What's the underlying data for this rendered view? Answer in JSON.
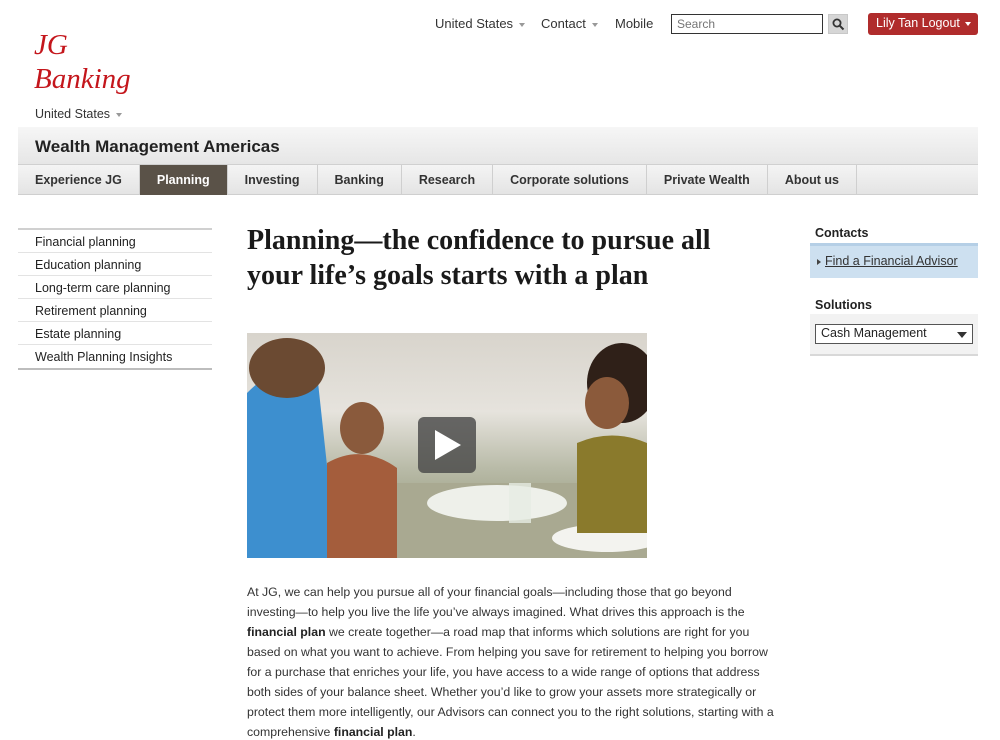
{
  "utility": {
    "country": "United States",
    "contact": "Contact",
    "mobile": "Mobile",
    "search_placeholder": "Search",
    "logout": "Lily Tan Logout"
  },
  "logo": {
    "line1": "JG",
    "line2": "Banking"
  },
  "region": "United States",
  "section_title": "Wealth Management Americas",
  "nav": {
    "tabs": [
      {
        "label": "Experience JG"
      },
      {
        "label": "Planning",
        "active": true
      },
      {
        "label": "Investing"
      },
      {
        "label": "Banking"
      },
      {
        "label": "Research"
      },
      {
        "label": "Corporate solutions"
      },
      {
        "label": "Private Wealth"
      },
      {
        "label": "About us"
      }
    ]
  },
  "sidebar": {
    "items": [
      {
        "label": "Financial planning"
      },
      {
        "label": "Education planning"
      },
      {
        "label": "Long-term care planning"
      },
      {
        "label": "Retirement planning"
      },
      {
        "label": "Estate planning"
      },
      {
        "label": "Wealth Planning Insights"
      }
    ]
  },
  "main": {
    "headline": "Planning—the confidence to pursue all your life’s goals starts with a plan",
    "video_icon": "play-icon",
    "body": {
      "p1": "At JG, we can help you pursue all of your financial goals—including those that go beyond investing—to help you live the life you’ve always imagined. What drives this approach is the ",
      "b1": "financial plan",
      "p2": " we create together—a road map that informs which solutions are right for you based on what you want to achieve. From helping you save for retirement to helping you borrow for a purchase that enriches your life, you have access to a wide range of options that address both sides of your balance sheet. Whether you’d like to grow your assets more strategically or protect them more intelligently, our Advisors can connect you to the right solutions, starting with a comprehensive ",
      "b2": "financial plan",
      "p3": "."
    }
  },
  "rail": {
    "contacts_title": "Contacts",
    "contacts_link": "Find a Financial Advisor",
    "solutions_title": "Solutions",
    "solutions_selected": "Cash Management"
  },
  "colors": {
    "brand_red": "#c4161c",
    "logout_bg": "#b02c2c",
    "active_tab": "#5a5248",
    "contacts_bg": "#cde0f0"
  }
}
